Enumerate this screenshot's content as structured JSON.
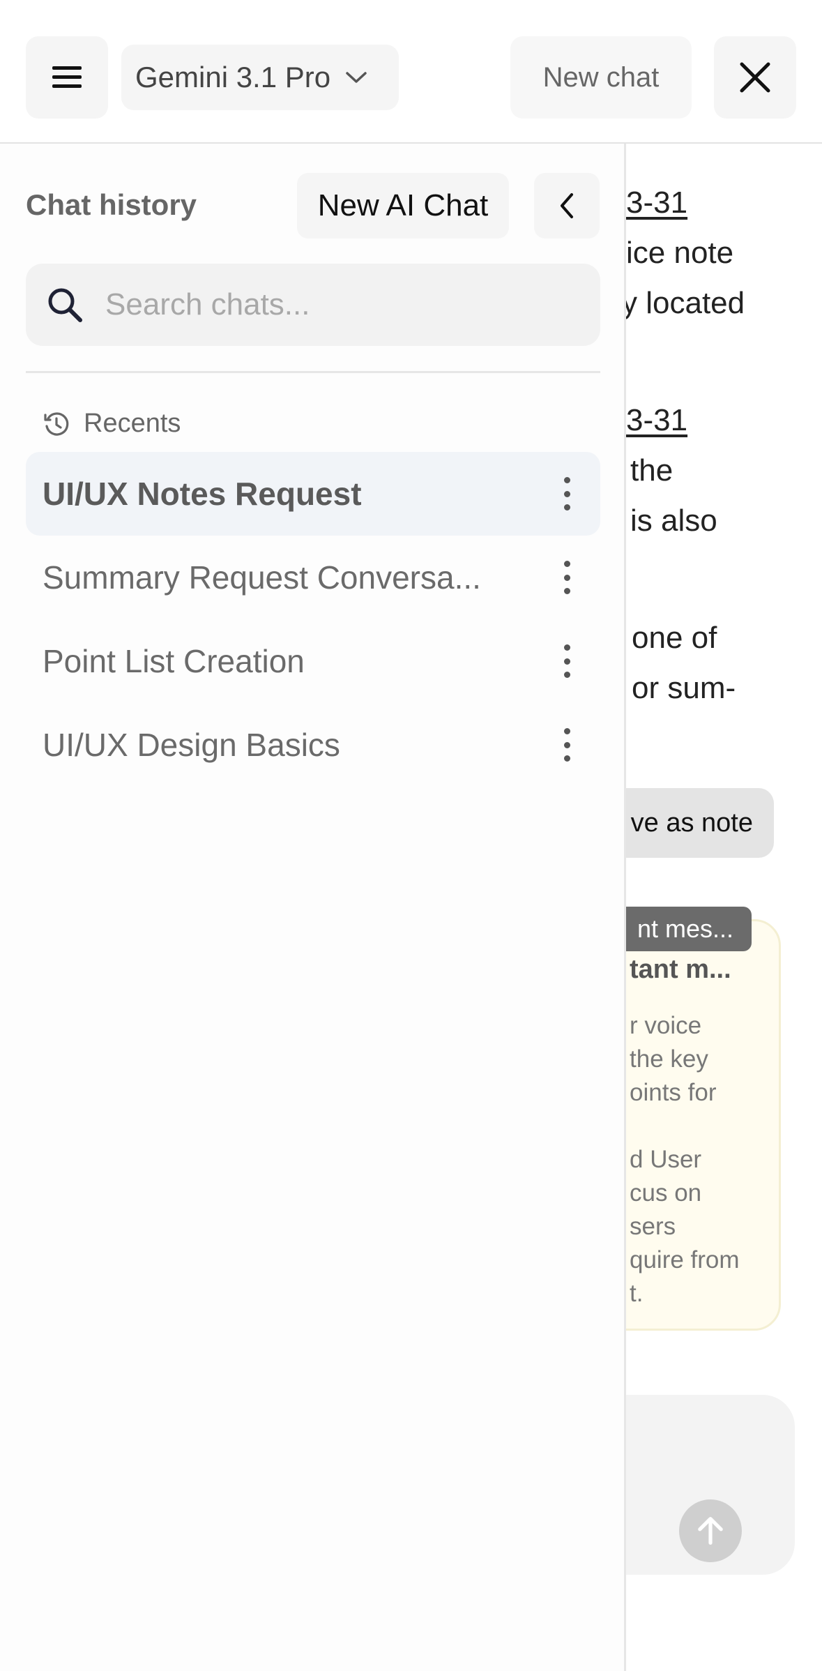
{
  "topbar": {
    "model_label": "Gemini 3.1 Pro",
    "new_chat_label": "New chat",
    "icons": {
      "menu": "menu-icon",
      "chevron": "chevron-down-icon",
      "close": "close-icon"
    }
  },
  "sidebar": {
    "title": "Chat history",
    "new_ai_chat_label": "New AI Chat",
    "search": {
      "placeholder": "Search chats...",
      "value": ""
    },
    "recents_label": "Recents",
    "items": [
      {
        "label": "UI/UX Notes Request",
        "active": true
      },
      {
        "label": "Summary Request Conversa...",
        "active": false
      },
      {
        "label": "Point List Creation",
        "active": false
      },
      {
        "label": "UI/UX Design Basics",
        "active": false
      }
    ]
  },
  "background_chat": {
    "lines": [
      {
        "text": "3-31",
        "underline": true
      },
      {
        "text": "ice note",
        "underline": false
      },
      {
        "text": "y located",
        "underline": false
      },
      {
        "text": "3-31",
        "underline": true
      },
      {
        "text": "the",
        "underline": false
      },
      {
        "text": "is also",
        "underline": false
      },
      {
        "text": "one of",
        "underline": false
      },
      {
        "text": "or sum-",
        "underline": false
      }
    ],
    "save_note_label": "ve as note",
    "card_tag": "nt mes...",
    "card_title": "tant m...",
    "card_lines": [
      "r voice",
      "the key",
      "oints for",
      "",
      "d User",
      "cus on",
      "sers",
      "quire from",
      "t."
    ]
  },
  "colors": {
    "active_item_bg": "#f1f4f8",
    "card_bg": "#fffcef",
    "tag_bg": "#6b6b6b"
  }
}
